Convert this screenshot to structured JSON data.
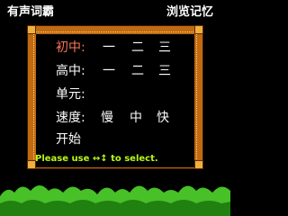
{
  "header": {
    "left_title": "有声词霸",
    "right_title": "浏览记忆"
  },
  "menu": {
    "level": {
      "label": "初中:",
      "options": [
        "一",
        "二",
        "三"
      ]
    },
    "grade": {
      "label": "高中:",
      "options": [
        "一",
        "二",
        "三"
      ]
    },
    "unit": {
      "label": "单元:"
    },
    "speed": {
      "label": "速度:",
      "options": [
        "慢",
        "中",
        "快"
      ]
    },
    "start": {
      "label": "开始"
    }
  },
  "hint": "Please use ↔↕ to select.",
  "colors": {
    "background": "#000000",
    "frame": "#c06a12",
    "highlight": "#f87858",
    "hint": "#b8f818",
    "grass": "#48c028"
  }
}
